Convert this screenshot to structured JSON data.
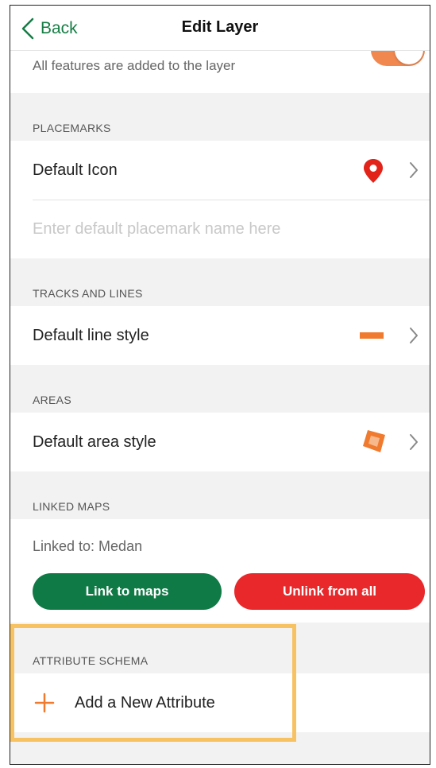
{
  "navbar": {
    "back_label": "Back",
    "title": "Edit Layer"
  },
  "top_setting": {
    "description": "All features are added to the layer",
    "toggle_on": true,
    "toggle_color": "#f0884f"
  },
  "placemarks": {
    "header": "PLACEMARKS",
    "default_icon_label": "Default Icon",
    "icon_name": "map-pin-icon",
    "icon_color": "#e2231a",
    "name_placeholder": "Enter default placemark name here"
  },
  "tracks": {
    "header": "TRACKS AND LINES",
    "default_line_label": "Default line style",
    "line_color": "#f07a2e"
  },
  "areas": {
    "header": "AREAS",
    "default_area_label": "Default area style",
    "area_color": "#f07a2e"
  },
  "linked_maps": {
    "header": "LINKED MAPS",
    "linked_to": "Linked to: Medan",
    "link_button": "Link to maps",
    "unlink_button": "Unlink from all",
    "link_color": "#107a46",
    "unlink_color": "#e8282a"
  },
  "attribute_schema": {
    "header": "ATTRIBUTE SCHEMA",
    "add_label": "Add a New Attribute",
    "plus_color": "#f07a2e"
  },
  "accent": "#167d45",
  "highlight_color": "#f7c261"
}
